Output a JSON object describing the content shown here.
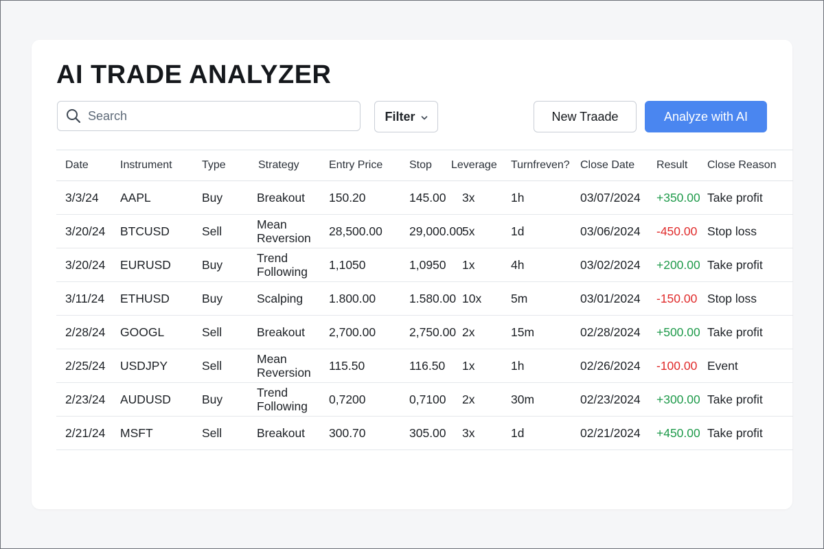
{
  "app": {
    "title": "AI TRADE ANALYZER"
  },
  "toolbar": {
    "search_placeholder": "Search",
    "search_value": "",
    "filter_label": "Filter",
    "new_trade_label": "New Traade",
    "analyze_label": "Analyze with AI"
  },
  "colors": {
    "accent": "#4a86f0",
    "positive": "#1e9a4a",
    "negative": "#e02b2b"
  },
  "icons": {
    "search": "search-icon",
    "filter_chevron": "chevron-down-icon"
  },
  "table": {
    "columns": [
      "Date",
      "Instrument",
      "Type",
      "Strategy",
      "Entry Price",
      "Stop",
      "Leverage",
      "Turnfreven?",
      "Close Date",
      "Result",
      "Close Reason"
    ],
    "rows": [
      {
        "date": "3/3/24",
        "instrument": "AAPL",
        "type": "Buy",
        "strategy": "Breakout",
        "entry": "150.20",
        "stop": "145.00",
        "leverage": "3x",
        "turnover": "1h",
        "close_date": "03/07/2024",
        "result": "+350.00",
        "close_reason": "Take profit"
      },
      {
        "date": "3/20/24",
        "instrument": "BTCUSD",
        "type": "Sell",
        "strategy": "Mean Reversion",
        "entry": "28,500.00",
        "stop": "29,000.00",
        "leverage": "5x",
        "turnover": "1d",
        "close_date": "03/06/2024",
        "result": "-450.00",
        "close_reason": "Stop loss"
      },
      {
        "date": "3/20/24",
        "instrument": "EURUSD",
        "type": "Buy",
        "strategy": "Trend Following",
        "entry": "1,1050",
        "stop": "1,0950",
        "leverage": "1x",
        "turnover": "4h",
        "close_date": "03/02/2024",
        "result": "+200.00",
        "close_reason": "Take profit"
      },
      {
        "date": "3/11/24",
        "instrument": "ETHUSD",
        "type": "Buy",
        "strategy": "Scalping",
        "entry": "1.800.00",
        "stop": "1.580.00",
        "leverage": "10x",
        "turnover": "5m",
        "close_date": "03/01/2024",
        "result": "-150.00",
        "close_reason": "Stop loss"
      },
      {
        "date": "2/28/24",
        "instrument": "GOOGL",
        "type": "Sell",
        "strategy": "Breakout",
        "entry": "2,700.00",
        "stop": "2,750.00",
        "leverage": "2x",
        "turnover": "15m",
        "close_date": "02/28/2024",
        "result": "+500.00",
        "close_reason": "Take profit"
      },
      {
        "date": "2/25/24",
        "instrument": "USDJPY",
        "type": "Sell",
        "strategy": "Mean Reversion",
        "entry": "115.50",
        "stop": "116.50",
        "leverage": "1x",
        "turnover": "1h",
        "close_date": "02/26/2024",
        "result": "-100.00",
        "close_reason": "Event"
      },
      {
        "date": "2/23/24",
        "instrument": "AUDUSD",
        "type": "Buy",
        "strategy": "Trend Following",
        "entry": "0,7200",
        "stop": "0,7100",
        "leverage": "2x",
        "turnover": "30m",
        "close_date": "02/23/2024",
        "result": "+300.00",
        "close_reason": "Take profit"
      },
      {
        "date": "2/21/24",
        "instrument": "MSFT",
        "type": "Sell",
        "strategy": "Breakout",
        "entry": "300.70",
        "stop": "305.00",
        "leverage": "3x",
        "turnover": "1d",
        "close_date": "02/21/2024",
        "result": "+450.00",
        "close_reason": "Take profit"
      }
    ]
  }
}
